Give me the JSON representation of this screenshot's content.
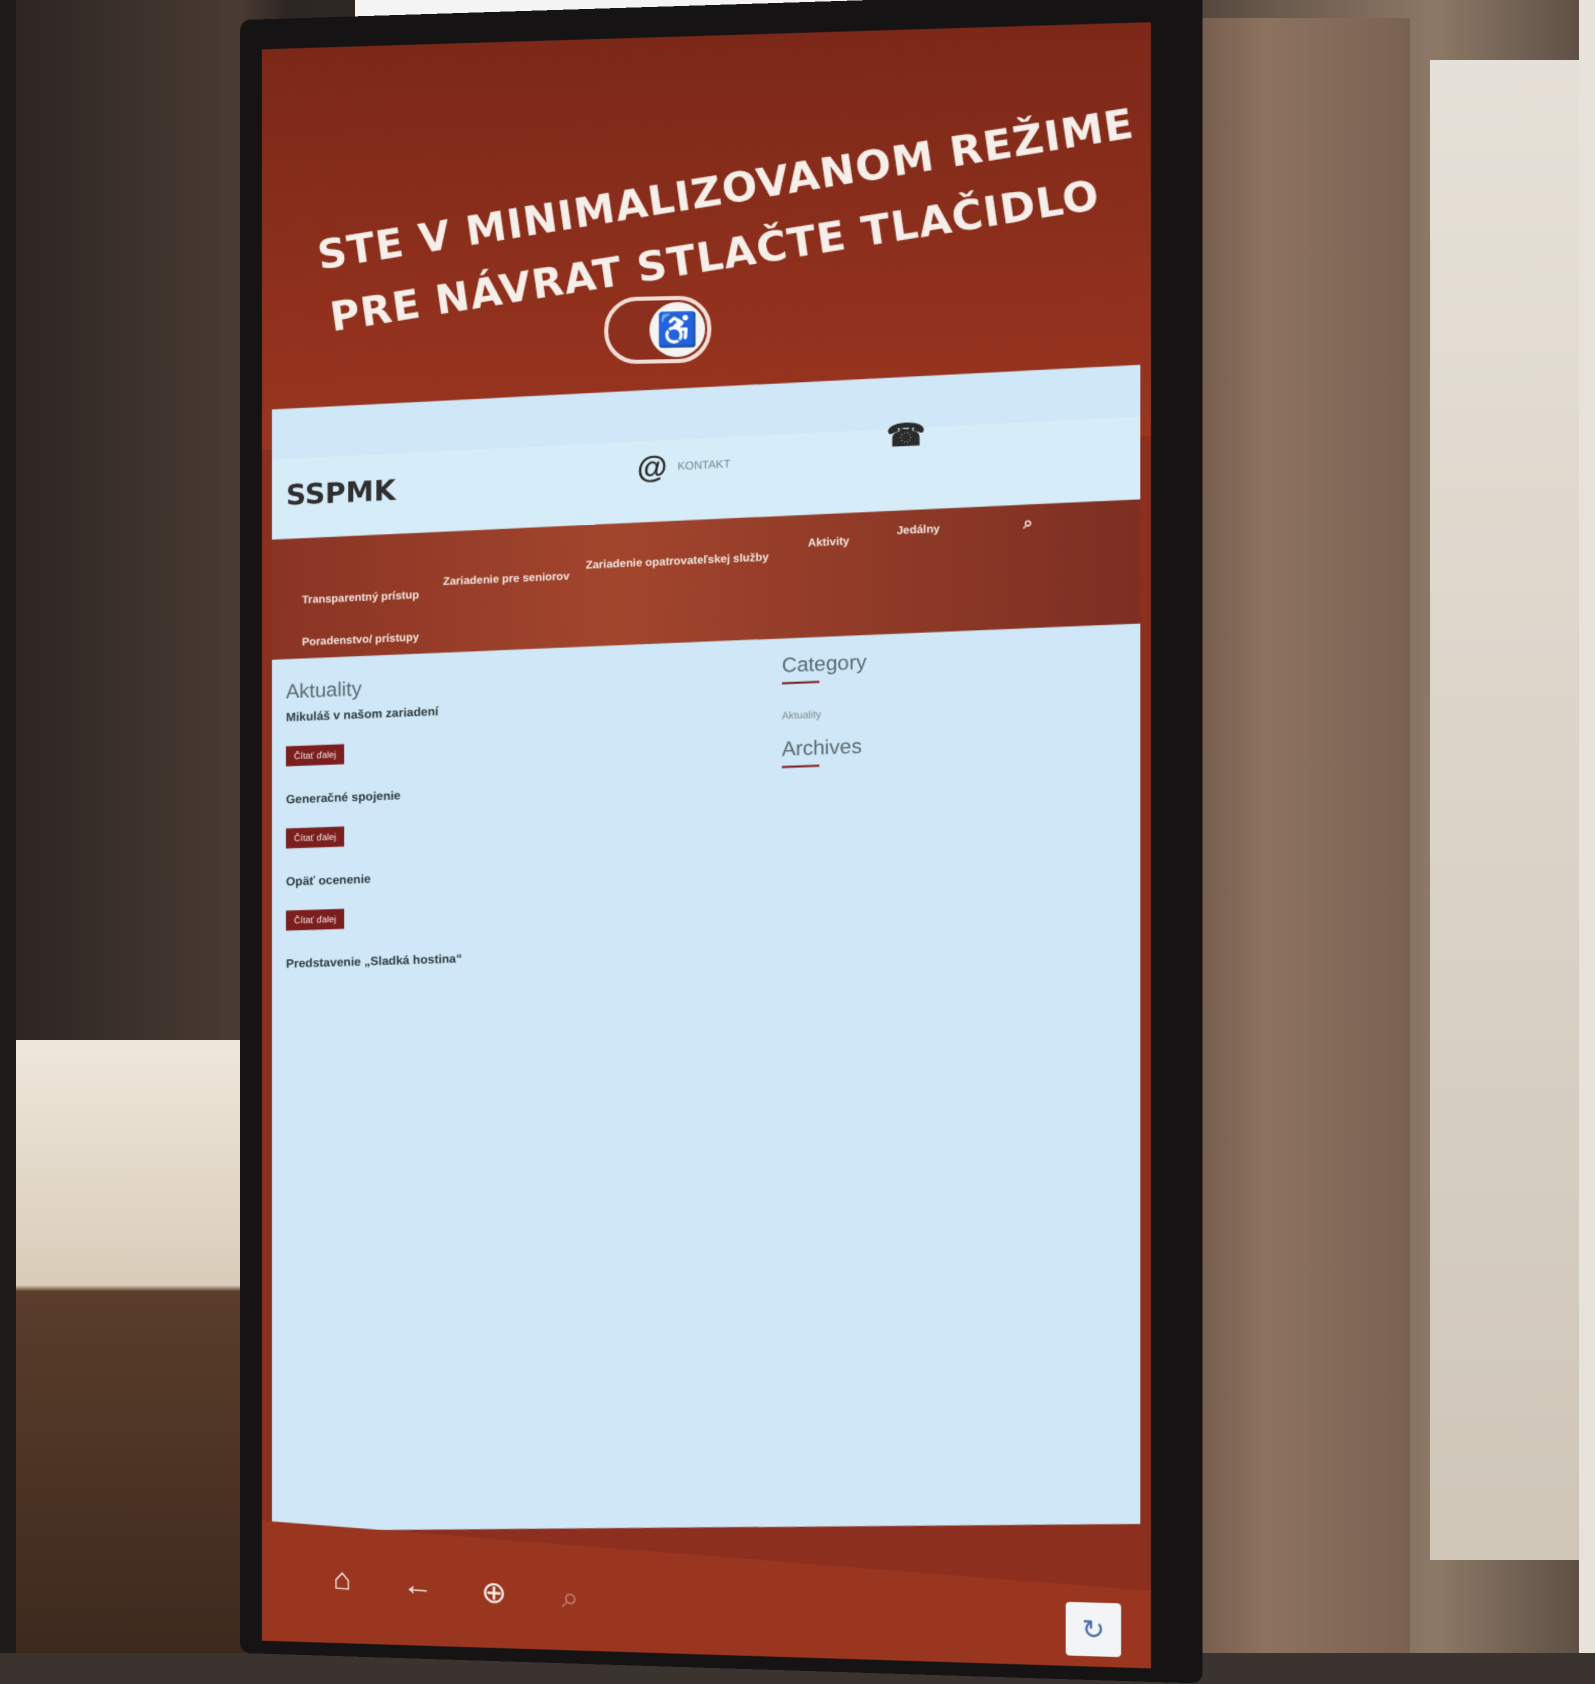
{
  "banner": {
    "line1": "STE V MINIMALIZOVANOM REŽIME",
    "line2": "PRE NÁVRAT STLAČTE TLAČIDLO",
    "toggle_icon": "wheelchair-icon"
  },
  "site": {
    "logo": "SSPMK",
    "logo_sub": "",
    "email_label": "KONTAKT",
    "email_value": "",
    "phone_label": "",
    "phone_value": ""
  },
  "nav": {
    "items": [
      {
        "label": "Transparentný prístup"
      },
      {
        "label": "Zariadenie pre seniorov"
      },
      {
        "label": "Zariadenie opatrovateľskej služby"
      },
      {
        "label": "Aktivity"
      },
      {
        "label": "Jedálny"
      },
      {
        "label": "Poradenstvo/ prístupy"
      },
      {
        "label": ""
      },
      {
        "label": ""
      }
    ]
  },
  "main": {
    "section_title": "Aktuality",
    "posts": [
      {
        "title": "Mikuláš v našom zariadení",
        "meta": "",
        "body": "",
        "read_more": "Čítať ďalej"
      },
      {
        "title": "Generačné spojenie",
        "meta": "",
        "body": "",
        "read_more": "Čítať ďalej"
      },
      {
        "title": "Opäť ocenenie",
        "meta": "",
        "body": "",
        "read_more": "Čítať ďalej"
      },
      {
        "title": "Predstavenie „Sladká hostina“",
        "meta": "",
        "body": "",
        "read_more": ""
      }
    ]
  },
  "sidebar": {
    "category_title": "Category",
    "categories": [
      {
        "label": "Aktuality"
      },
      {
        "label": ""
      },
      {
        "label": ""
      },
      {
        "label": ""
      },
      {
        "label": ""
      },
      {
        "label": ""
      }
    ],
    "archives_title": "Archives",
    "archives": [
      {
        "label": ""
      },
      {
        "label": ""
      },
      {
        "label": ""
      },
      {
        "label": ""
      },
      {
        "label": ""
      },
      {
        "label": ""
      },
      {
        "label": ""
      },
      {
        "label": ""
      },
      {
        "label": ""
      },
      {
        "label": ""
      },
      {
        "label": ""
      },
      {
        "label": ""
      },
      {
        "label": ""
      },
      {
        "label": ""
      },
      {
        "label": ""
      },
      {
        "label": ""
      },
      {
        "label": ""
      },
      {
        "label": ""
      },
      {
        "label": ""
      },
      {
        "label": ""
      },
      {
        "label": ""
      },
      {
        "label": ""
      }
    ]
  },
  "bottom_bar": {
    "home_icon": "home-icon",
    "back_icon": "back-arrow-icon",
    "zoom_icon": "zoom-in-icon",
    "search_icon": "search-icon"
  },
  "colors": {
    "banner_red": "#8d2f1f",
    "nav_red": "#9a3520",
    "website_bg": "#cfe7f6",
    "button_maroon": "#7b1e1e"
  }
}
